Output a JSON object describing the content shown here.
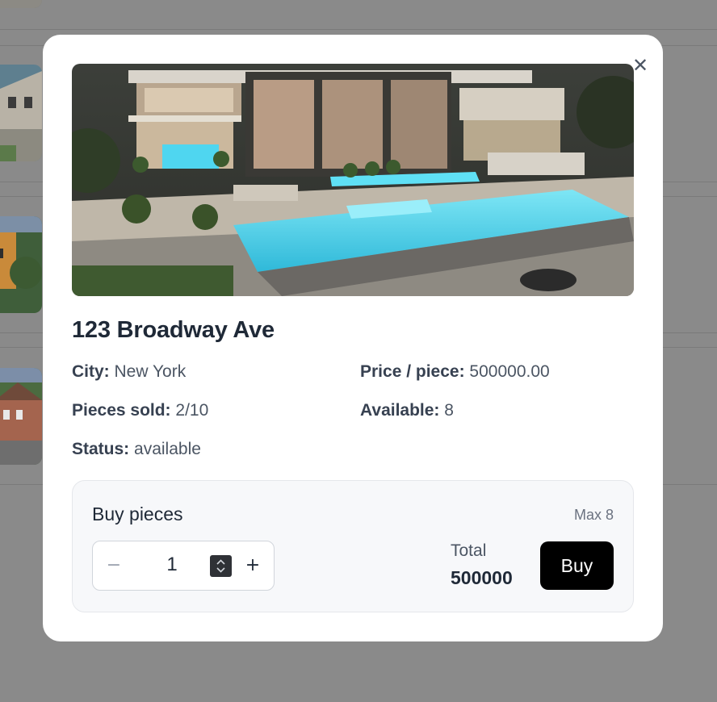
{
  "modal": {
    "close_icon": "close-icon",
    "title": "123 Broadway Ave",
    "details": {
      "city_label": "City:",
      "city_value": "New York",
      "price_label": "Price / piece:",
      "price_value": "500000.00",
      "sold_label": "Pieces sold:",
      "sold_value": "2/10",
      "available_label": "Available:",
      "available_value": "8",
      "status_label": "Status:",
      "status_value": "available"
    },
    "buy": {
      "heading": "Buy pieces",
      "max_text": "Max 8",
      "minus_symbol": "−",
      "quantity": "1",
      "plus_symbol": "+",
      "total_label": "Total",
      "total_value": "500000",
      "button_label": "Buy"
    }
  },
  "colors": {
    "overlay": "#808080",
    "modal_bg": "#ffffff",
    "buy_box_bg": "#f7f8fa",
    "buy_button": "#000000",
    "pool_water": "#4fd6f0"
  }
}
